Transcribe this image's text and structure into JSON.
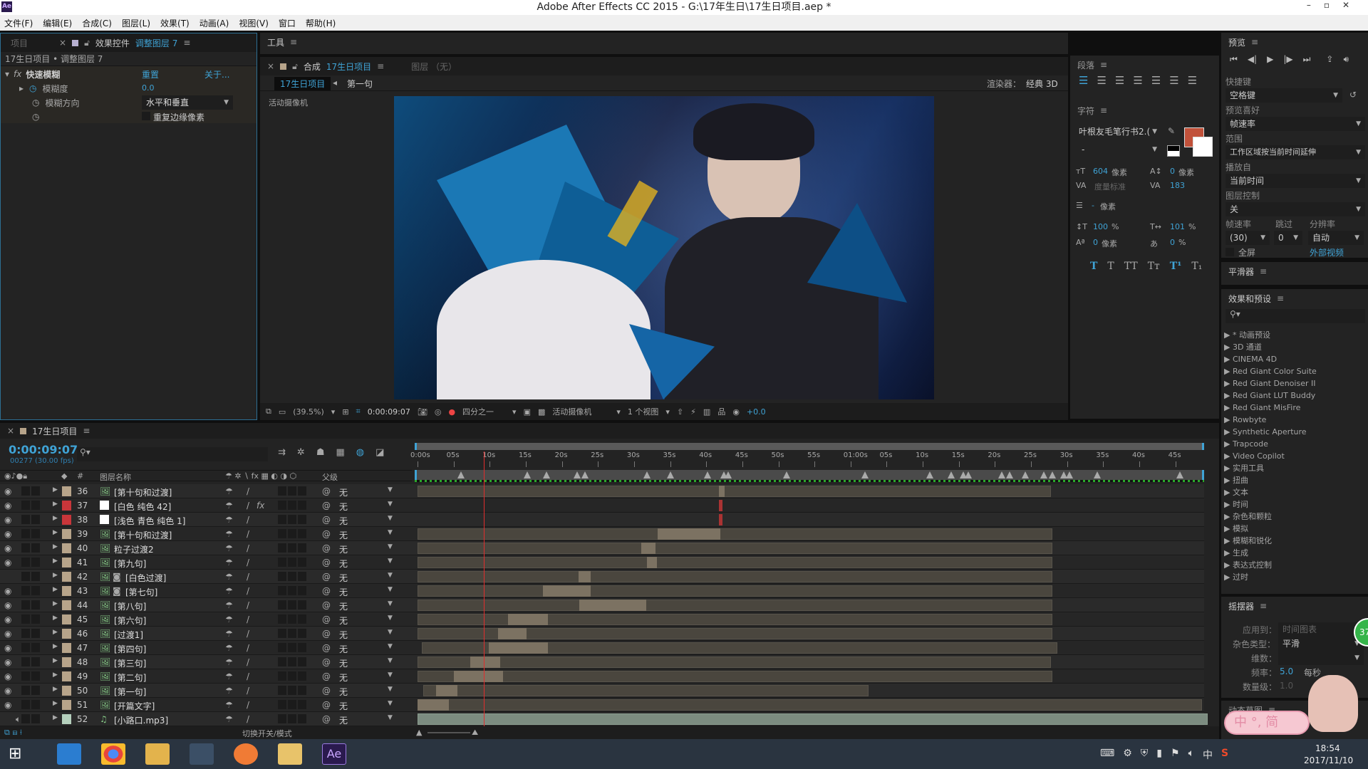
{
  "window": {
    "title": "Adobe After Effects CC 2015 - G:\\17年生日\\17生日项目.aep *",
    "logo": "Ae"
  },
  "menu": [
    "文件(F)",
    "编辑(E)",
    "合成(C)",
    "图层(L)",
    "效果(T)",
    "动画(A)",
    "视图(V)",
    "窗口",
    "帮助(H)"
  ],
  "effect_controls": {
    "tab_project": "项目",
    "tab_label": "效果控件",
    "tab_layer": "调整图层 7",
    "breadcrumb": "17生日项目 • 调整图层 7",
    "effect_name": "快速模糊",
    "reset": "重置",
    "about": "关于...",
    "props": [
      {
        "name": "模糊度",
        "value": "0.0"
      },
      {
        "name": "模糊方向",
        "value": "水平和垂直"
      }
    ],
    "checkbox_label": "重复边缘像素",
    "checkbox_checked": false
  },
  "tools": {
    "label": "工具"
  },
  "composition": {
    "tab_label": "合成",
    "tab_name": "17生日项目",
    "layer_tab": "图层 （无）",
    "breadcrumb": [
      "17生日项目",
      "第一句"
    ],
    "renderer_label": "渲染器：",
    "renderer_value": "经典 3D",
    "camera_label": "活动摄像机",
    "toolbar": {
      "zoom": "(39.5%)",
      "timecode": "0:00:09:07",
      "resolution": "四分之一",
      "camera": "活动摄像机",
      "views": "1 个视图",
      "exposure": "+0.0"
    }
  },
  "paragraph": {
    "title": "段落"
  },
  "character": {
    "title": "字符",
    "font": "叶根友毛笔行书2.(",
    "style": "-",
    "fill_color": "#c1513a",
    "size": "604",
    "size_unit": "像素",
    "leading": "0",
    "leading_unit": "像素",
    "kerning": "度量标准",
    "tracking": "183",
    "stroke": "-",
    "stroke_unit": "像素",
    "vscale": "100",
    "vscale_unit": "%",
    "hscale": "101",
    "hscale_unit": "%",
    "baseline": "0",
    "baseline_unit": "像素",
    "tsume": "0",
    "tsume_unit": "%",
    "styles": [
      "T",
      "T",
      "TT",
      "Tт",
      "T¹",
      "T₁"
    ]
  },
  "preview": {
    "title": "预览",
    "shortcut_label": "快捷键",
    "shortcut": "空格键",
    "pref_label": "预览喜好",
    "pref": "帧速率",
    "range_label": "范围",
    "range": "工作区域按当前时间延伸",
    "play_from_label": "播放自",
    "play_from": "当前时间",
    "layer_ctrl_label": "图层控制",
    "layer_ctrl": "关",
    "fps_label": "帧速率",
    "fps": "(30)",
    "skip_label": "跳过",
    "skip": "0",
    "res_label": "分辨率",
    "res": "自动",
    "fullscreen": "全屏",
    "external": "外部视频"
  },
  "smoother": {
    "title": "平滑器"
  },
  "effects_presets": {
    "title": "效果和预设",
    "items": [
      "* 动画预设",
      "3D 通道",
      "CINEMA 4D",
      "Red Giant Color Suite",
      "Red Giant Denoiser II",
      "Red Giant LUT Buddy",
      "Red Giant MisFire",
      "Rowbyte",
      "Synthetic Aperture",
      "Trapcode",
      "Video Copilot",
      "实用工具",
      "扭曲",
      "文本",
      "时间",
      "杂色和颗粒",
      "模拟",
      "模糊和锐化",
      "生成",
      "表达式控制",
      "过时"
    ]
  },
  "wiggler": {
    "title": "摇摆器",
    "apply_label": "应用到：",
    "apply": "时间图表",
    "noise_label": "杂色类型：",
    "noise": "平滑",
    "dim_label": "维数：",
    "freq_label": "频率：",
    "freq": "5.0",
    "freq_unit": "每秒",
    "mag_label": "数量级：",
    "mag": "1.0"
  },
  "motion_sketch": {
    "title": "动态草图"
  },
  "ime": {
    "text": "中 °, 简",
    "badge": "37"
  },
  "timeline": {
    "tab": "17生日项目",
    "timecode": "0:00:09:07",
    "frame_info": "00277 (30.00 fps)",
    "col_num": "#",
    "col_name": "图层名称",
    "col_parent": "父级",
    "toggle_label": "切换开关/模式",
    "playhead_s": 9.23,
    "duration_s": 109,
    "ruler": [
      "0:00s",
      "05s",
      "10s",
      "15s",
      "20s",
      "25s",
      "30s",
      "35s",
      "40s",
      "45s",
      "50s",
      "55s",
      "01:00s",
      "05s",
      "10s",
      "15s",
      "20s",
      "25s",
      "30s",
      "35s",
      "40s",
      "45s"
    ],
    "markers_s": [
      5.5,
      14.7,
      17.4,
      21.6,
      22.7,
      31.3,
      34.6,
      39.7,
      42,
      42.5,
      50.6,
      61.5,
      70.5,
      73.4,
      75.1,
      75.8,
      80.5,
      81.5,
      83.7,
      86.3,
      87.5,
      89,
      89.8,
      93.7,
      105.1
    ],
    "layers": [
      {
        "num": "36",
        "name": "[第十句和过渡]",
        "label": "#b7a48a",
        "type": "image",
        "visible": true,
        "bar": [
          0,
          87.8
        ],
        "active": [
          41.8,
          42.5
        ],
        "parent": "无"
      },
      {
        "num": "37",
        "name": "[白色 纯色 42]",
        "label": "#c9363a",
        "type": "solid-white",
        "visible": true,
        "fx": true,
        "marker": 41.8,
        "parent": "无"
      },
      {
        "num": "38",
        "name": "[浅色 青色 纯色 1]",
        "label": "#c9363a",
        "type": "solid-cyan",
        "visible": true,
        "marker": 41.8,
        "parent": "无"
      },
      {
        "num": "39",
        "name": "[第十句和过渡]",
        "label": "#b7a48a",
        "type": "image",
        "visible": true,
        "bar": [
          0,
          88
        ],
        "active": [
          33.3,
          42
        ],
        "parent": "无"
      },
      {
        "num": "40",
        "name": "粒子过渡2",
        "label": "#b7a48a",
        "type": "image",
        "visible": true,
        "bar": [
          0,
          88
        ],
        "active": [
          31,
          33
        ],
        "parent": "无"
      },
      {
        "num": "41",
        "name": "[第九句]",
        "label": "#b7a48a",
        "type": "image",
        "visible": true,
        "bar": [
          0,
          88
        ],
        "active": [
          31.8,
          33.2
        ],
        "parent": "无"
      },
      {
        "num": "42",
        "name": "[白色过渡]",
        "label": "#b7a48a",
        "type": "image",
        "mask": true,
        "visible": false,
        "bar": [
          0,
          88
        ],
        "active": [
          22.3,
          24
        ],
        "parent": "无"
      },
      {
        "num": "43",
        "name": "[第七句]",
        "label": "#b7a48a",
        "type": "image",
        "mask": true,
        "visible": true,
        "bar": [
          0,
          88
        ],
        "active": [
          17.4,
          24
        ],
        "parent": "无"
      },
      {
        "num": "44",
        "name": "[第八句]",
        "label": "#b7a48a",
        "type": "image",
        "visible": true,
        "bar": [
          0,
          88
        ],
        "active": [
          22.4,
          31.7
        ],
        "parent": "无"
      },
      {
        "num": "45",
        "name": "[第六句]",
        "label": "#b7a48a",
        "type": "image",
        "visible": true,
        "bar": [
          0,
          88
        ],
        "active": [
          12.5,
          18.1
        ],
        "parent": "无"
      },
      {
        "num": "46",
        "name": "[过渡1]",
        "label": "#b7a48a",
        "type": "image",
        "visible": true,
        "bar": [
          0,
          88
        ],
        "active": [
          11.2,
          15.1
        ],
        "parent": "无"
      },
      {
        "num": "47",
        "name": "[第四句]",
        "label": "#b7a48a",
        "type": "image",
        "visible": true,
        "bar": [
          0.6,
          88.6
        ],
        "active": [
          9.9,
          18.1
        ],
        "parent": "无"
      },
      {
        "num": "48",
        "name": "[第三句]",
        "label": "#b7a48a",
        "type": "image",
        "visible": true,
        "bar": [
          0,
          87.8
        ],
        "active": [
          7.3,
          11.5
        ],
        "parent": "无"
      },
      {
        "num": "49",
        "name": "[第二句]",
        "label": "#b7a48a",
        "type": "image",
        "visible": true,
        "bar": [
          0,
          88
        ],
        "active": [
          5,
          11.8
        ],
        "parent": "无"
      },
      {
        "num": "50",
        "name": "[第一句]",
        "label": "#b7a48a",
        "type": "image",
        "visible": true,
        "bar": [
          0.8,
          62.5
        ],
        "active": [
          2.6,
          5.5
        ],
        "parent": "无"
      },
      {
        "num": "51",
        "name": "[开篇文字]",
        "label": "#b7a48a",
        "type": "image",
        "visible": true,
        "bar": [
          0,
          108.7
        ],
        "active": [
          0,
          4.3
        ],
        "parent": "无"
      },
      {
        "num": "52",
        "name": "[小路口.mp3]",
        "label": "#b5d0bd",
        "type": "audio",
        "visible": false,
        "audio": true,
        "bar": [
          0,
          109.5
        ],
        "parent": "无"
      }
    ]
  },
  "taskbar": {
    "time": "18:54",
    "date": "2017/11/10",
    "ime": "中",
    "app": "Ae"
  }
}
